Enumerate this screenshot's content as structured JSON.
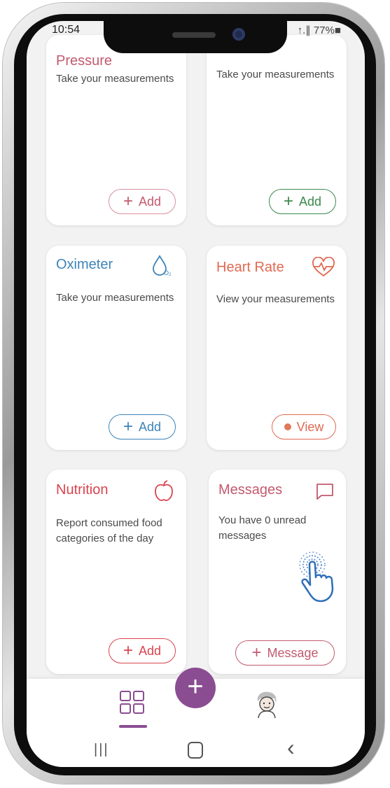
{
  "status_bar": {
    "time": "10:54",
    "right": "↑.∥ 77%■"
  },
  "cards": {
    "pressure": {
      "title": "Pressure",
      "desc": "Take your measurements",
      "button": "Add",
      "color": "#c25a6e"
    },
    "unnamed": {
      "desc": "Take your measurements",
      "button": "Add",
      "color": "#3a8a4e"
    },
    "oximeter": {
      "title": "Oximeter",
      "desc": "Take your measurements",
      "button": "Add",
      "color": "#3d84b8",
      "icon": "drop-o2-icon"
    },
    "heart_rate": {
      "title": "Heart Rate",
      "desc": "View your measurements",
      "button": "View",
      "color": "#e06a52",
      "icon": "heart-pulse-icon"
    },
    "nutrition": {
      "title": "Nutrition",
      "desc": "Report consumed food categories of the day",
      "button": "Add",
      "color": "#d9434f",
      "icon": "apple-icon"
    },
    "messages": {
      "title": "Messages",
      "desc": "You have 0 unread messages",
      "button": "Message",
      "color": "#c25a6e",
      "icon": "chat-bubble-icon"
    }
  },
  "bottom_nav": {
    "dashboard_icon": "grid-icon",
    "add_icon": "plus-icon",
    "profile_icon": "avatar-icon",
    "accent": "#8b4d92"
  },
  "system_nav": {
    "recents": "|||",
    "home": "◯",
    "back": "‹"
  }
}
